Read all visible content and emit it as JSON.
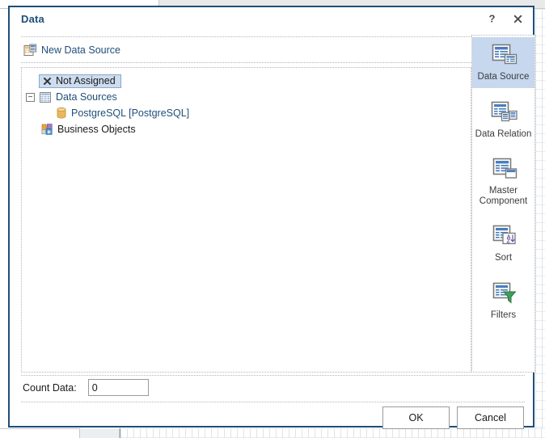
{
  "window": {
    "title": "Data",
    "help_button": "?",
    "close_button": "×",
    "help_icon": "question-mark-icon",
    "close_icon": "close-x-icon"
  },
  "header": {
    "new_data_source_label": "New Data Source",
    "new_data_source_icon": "new-data-source-icon"
  },
  "tree": {
    "nodes": [
      {
        "label": "Not Assigned",
        "icon": "cross-x-icon",
        "selected": true,
        "indent": 0,
        "expander": ""
      },
      {
        "label": "Data Sources",
        "icon": "table-grid-icon",
        "selected": false,
        "indent": 0,
        "expander": "−"
      },
      {
        "label": "PostgreSQL [PostgreSQL]",
        "icon": "database-cylinder-icon",
        "selected": false,
        "indent": 1,
        "expander": ""
      },
      {
        "label": "Business Objects",
        "icon": "business-objects-puzzle-icon",
        "selected": false,
        "indent": 0,
        "expander": ""
      }
    ]
  },
  "gallery": {
    "items": [
      {
        "label": "Data Source",
        "icon": "data-source-icon",
        "active": true
      },
      {
        "label": "Data Relation",
        "icon": "data-relation-icon",
        "active": false
      },
      {
        "label": "Master\nComponent",
        "icon": "master-component-icon",
        "active": false,
        "line1": "Master",
        "line2": "Component"
      },
      {
        "label": "Sort",
        "icon": "sort-az-icon",
        "active": false
      },
      {
        "label": "Filters",
        "icon": "filter-funnel-icon",
        "active": false
      }
    ]
  },
  "count": {
    "label": "Count Data:",
    "value": "0",
    "placeholder": ""
  },
  "footer": {
    "ok_label": "OK",
    "cancel_label": "Cancel"
  },
  "colors": {
    "dialog_border": "#1f4e79",
    "title_text": "#1f4e79",
    "selection_chip": "#cddcef",
    "gallery_active": "#c6d7ee",
    "tree_link_text": "#1f4e79",
    "icon_blue": "#4a7ebb",
    "icon_outline": "#7a7a7a",
    "funnel_green": "#3f9c5a",
    "db_gold": "#e3b457"
  }
}
